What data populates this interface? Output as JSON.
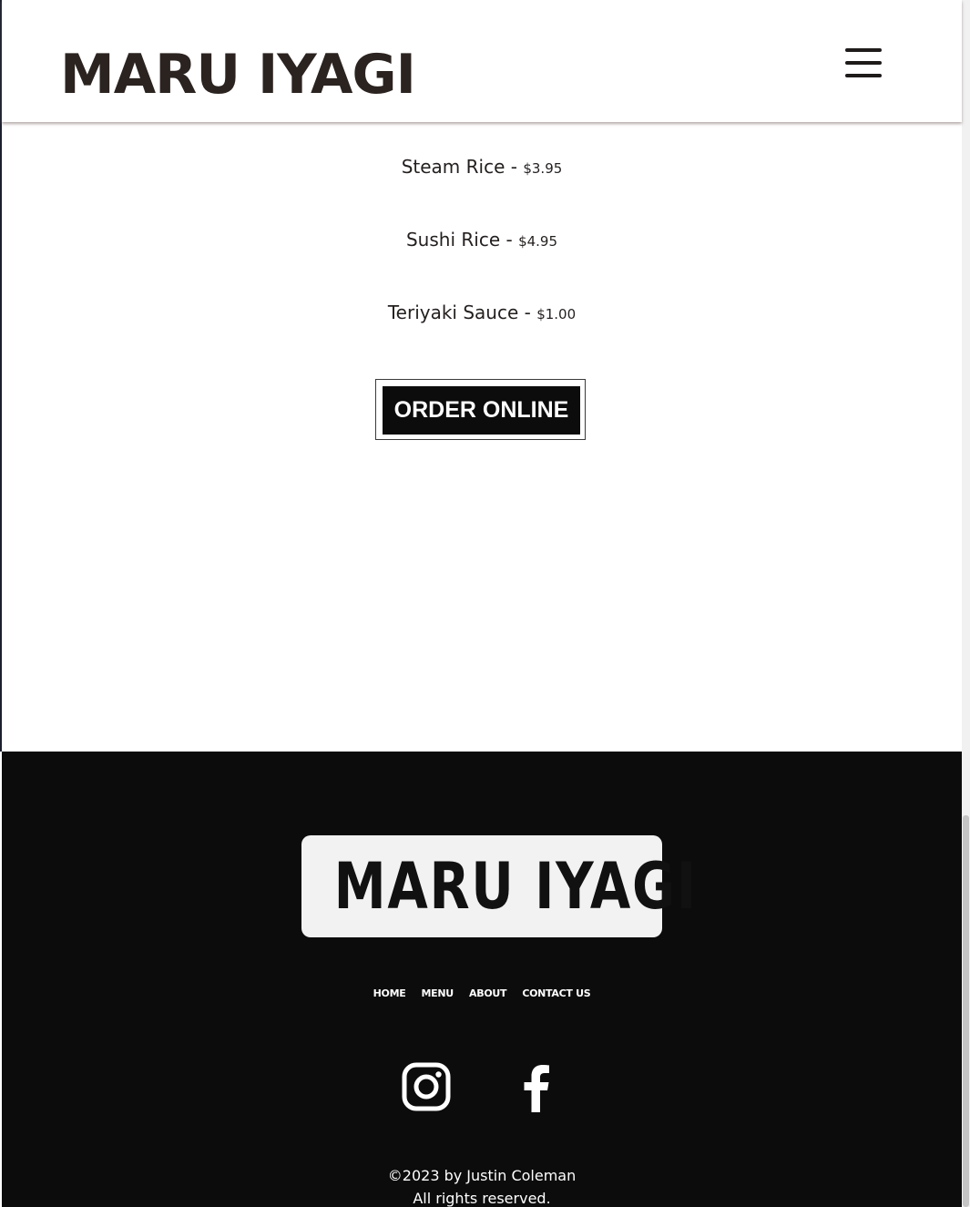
{
  "header": {
    "site_title": "MARU IYAGI",
    "menu_icon": "hamburger-menu-icon"
  },
  "menu": {
    "items": [
      {
        "name": "Steam Rice",
        "separator": " - ",
        "price": "$3.95"
      },
      {
        "name": "Sushi Rice",
        "separator": " - ",
        "price": "$4.95"
      },
      {
        "name": "Teriyaki Sauce",
        "separator": " - ",
        "price": "$1.00"
      }
    ],
    "order_button_label": "ORDER ONLINE"
  },
  "footer": {
    "logo_text": "MARU IYAGI",
    "nav": [
      {
        "label": "HOME"
      },
      {
        "label": "MENU"
      },
      {
        "label": "ABOUT"
      },
      {
        "label": "CONTACT US"
      }
    ],
    "social": [
      {
        "icon": "instagram-icon"
      },
      {
        "icon": "facebook-icon"
      }
    ],
    "copyright_line1": "©2023 by Justin Coleman",
    "copyright_line2": "All rights reserved."
  },
  "colors": {
    "header_bg": "#ffffff",
    "title_text": "#2b2320",
    "footer_bg": "#0c0c0c",
    "button_bg": "#0c0c0c",
    "logo_bg": "#f2f2f2"
  }
}
